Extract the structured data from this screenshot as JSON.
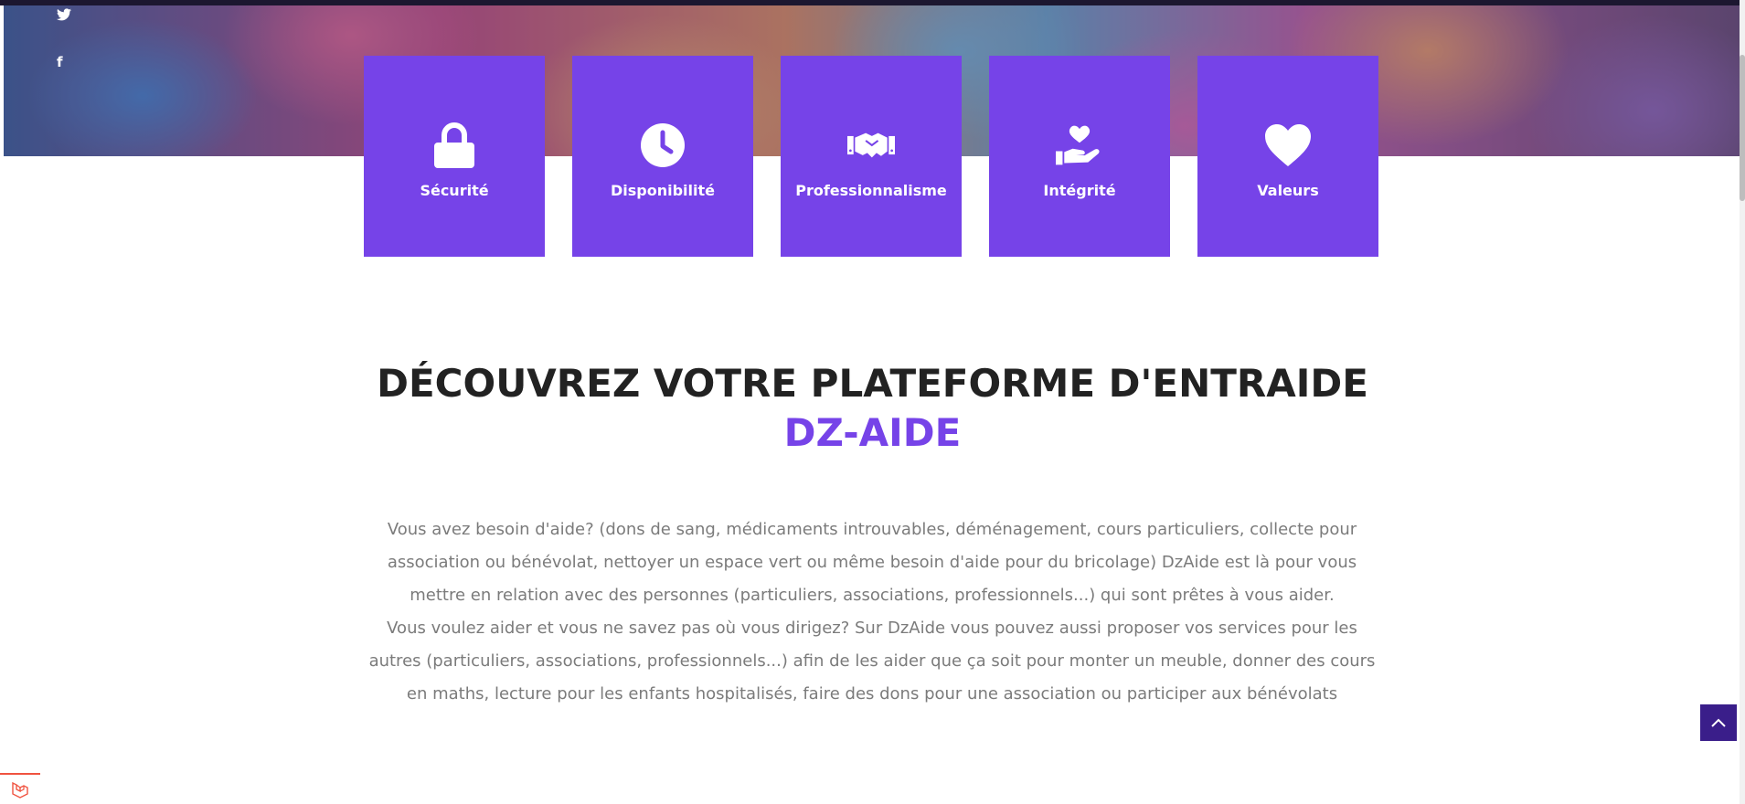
{
  "social": {
    "twitter_glyph": "🐦",
    "facebook_glyph": "f"
  },
  "features": [
    {
      "label": "Sécurité",
      "icon": "lock-icon"
    },
    {
      "label": "Disponibilité",
      "icon": "clock-icon"
    },
    {
      "label": "Professionnalisme",
      "icon": "handshake-icon"
    },
    {
      "label": "Intégrité",
      "icon": "hand-heart-icon"
    },
    {
      "label": "Valeurs",
      "icon": "heart-icon"
    }
  ],
  "section": {
    "title": "DÉCOUVREZ VOTRE PLATEFORME D'ENTRAIDE",
    "brand": "DZ-AIDE",
    "paragraph_1": "Vous avez besoin d'aide? (dons de sang, médicaments introuvables, déménagement, cours particuliers, collecte pour association ou bénévolat, nettoyer un espace vert ou même besoin d'aide pour du bricolage) DzAide est là pour vous mettre en relation avec des personnes (particuliers, associations, professionnels...) qui sont prêtes à vous aider.",
    "paragraph_2": "Vous voulez aider et vous ne savez pas où vous dirigez? Sur DzAide vous pouvez aussi proposer vos services pour les autres (particuliers, associations, professionnels...) afin de les aider que ça soit pour monter un meuble, donner des cours en maths, lecture pour les enfants hospitalisés, faire des dons pour une association ou participer aux bénévolats"
  },
  "colors": {
    "accent": "#7643e8",
    "back_to_top": "#3a1e8a",
    "heading": "#222222",
    "body_text": "#7b7b7b"
  }
}
